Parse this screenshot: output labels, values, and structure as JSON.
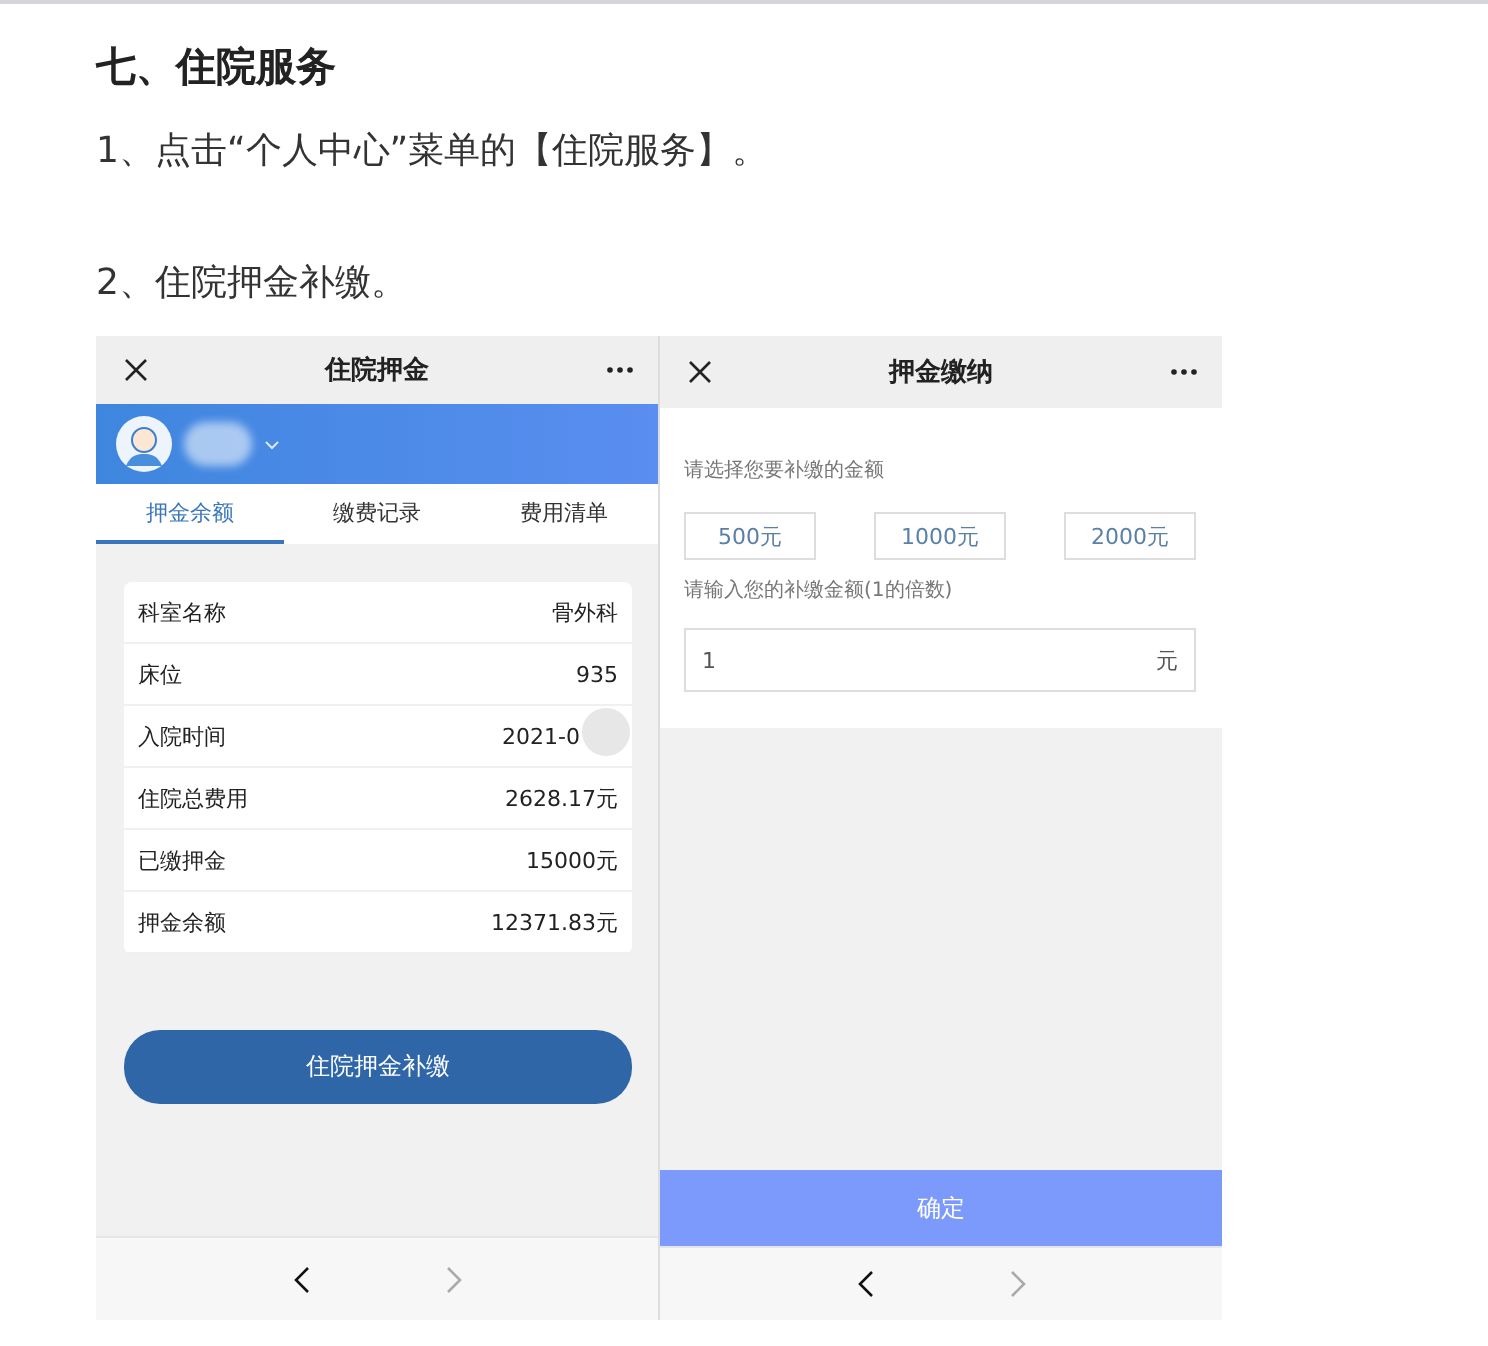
{
  "heading": "七、住院服务",
  "steps": [
    "1、点击“个人中心”菜单的【住院服务】。",
    "2、住院押金补缴。"
  ],
  "deposit_screen": {
    "nav_title": "住院押金",
    "tabs": [
      {
        "label": "押金余额",
        "selected": true
      },
      {
        "label": "缴费记录",
        "selected": false
      },
      {
        "label": "费用清单",
        "selected": false
      }
    ],
    "rows": [
      {
        "label": "科室名称",
        "value": "骨外科"
      },
      {
        "label": "床位",
        "value": "935"
      },
      {
        "label": "入院时间",
        "value": "2021-0"
      },
      {
        "label": "住院总费用",
        "value": "2628.17元"
      },
      {
        "label": "已缴押金",
        "value": "15000元"
      },
      {
        "label": "押金余额",
        "value": "12371.83元"
      }
    ],
    "button": "住院押金补缴"
  },
  "payment_screen": {
    "nav_title": "押金缴纳",
    "prompt": "请选择您要补缴的金额",
    "options": [
      {
        "label": "500元",
        "selected": false
      },
      {
        "label": "1000元",
        "selected": false
      },
      {
        "label": "2000元",
        "selected": false
      }
    ],
    "input_label": "请输入您的补缴金额(1的倍数)",
    "field": {
      "value": "1",
      "unit": "元"
    },
    "confirm": "确定"
  }
}
